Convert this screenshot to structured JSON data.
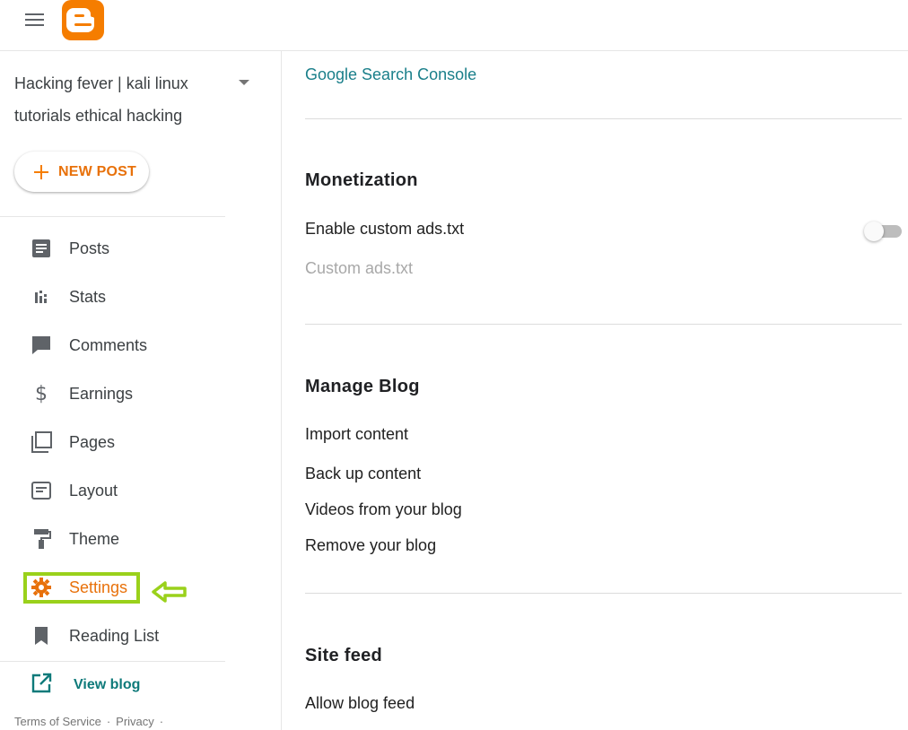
{
  "header": {
    "menu_icon": "hamburger-menu-icon",
    "logo_icon": "blogger-logo-icon"
  },
  "sidebar": {
    "blog_title_line1": "Hacking fever | kali linux",
    "blog_title_line2": "tutorials ethical hacking",
    "new_post_label": "NEW POST",
    "items": [
      {
        "label": "Posts",
        "icon": "posts-icon"
      },
      {
        "label": "Stats",
        "icon": "stats-icon"
      },
      {
        "label": "Comments",
        "icon": "comments-icon"
      },
      {
        "label": "Earnings",
        "icon": "dollar-icon"
      },
      {
        "label": "Pages",
        "icon": "pages-icon"
      },
      {
        "label": "Layout",
        "icon": "layout-icon"
      },
      {
        "label": "Theme",
        "icon": "paint-roller-icon"
      },
      {
        "label": "Settings",
        "icon": "gear-icon",
        "active": true
      },
      {
        "label": "Reading List",
        "icon": "bookmark-icon"
      }
    ],
    "view_blog_label": "View blog",
    "footer": {
      "terms": "Terms of Service",
      "privacy": "Privacy",
      "sep": "·"
    }
  },
  "main": {
    "search_console_link": "Google Search Console",
    "monetization": {
      "title": "Monetization",
      "enable_ads_label": "Enable custom ads.txt",
      "enable_ads_on": false,
      "custom_ads_label": "Custom ads.txt"
    },
    "manage_blog": {
      "title": "Manage Blog",
      "import": "Import content",
      "backup": "Back up content",
      "videos": "Videos from your blog",
      "remove": "Remove your blog"
    },
    "site_feed": {
      "title": "Site feed",
      "allow_feed": "Allow blog feed"
    }
  },
  "colors": {
    "brand_orange": "#f57d00",
    "active_text": "#e8710a",
    "link_teal": "#1a7f8a",
    "highlight_green": "#9ad11b"
  }
}
